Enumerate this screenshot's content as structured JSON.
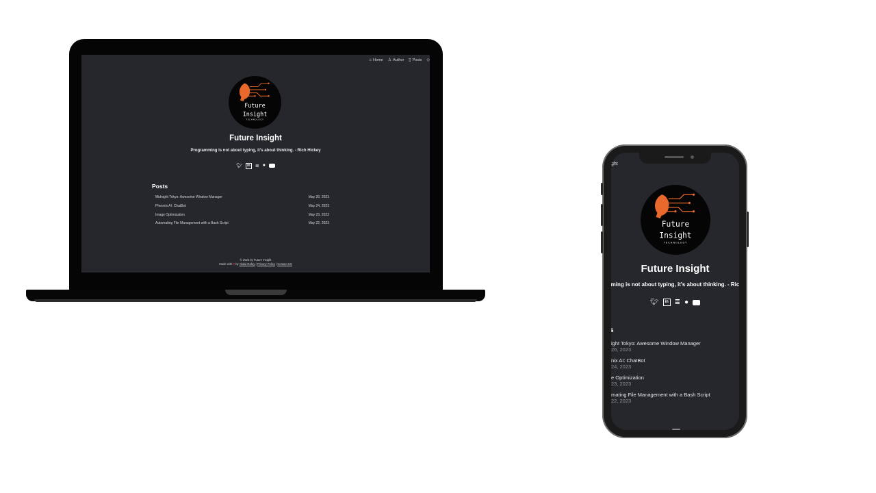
{
  "site": {
    "title": "Future Insight",
    "tagline": "Programming is not about typing, it's about thinking. - Rich Hickey",
    "logo_text_line1": "Future",
    "logo_text_line2": "Insight",
    "logo_text_line3": "TECHNOLOGY"
  },
  "nav": [
    {
      "label": "Home",
      "icon": "home-icon"
    },
    {
      "label": "Author",
      "icon": "user-icon"
    },
    {
      "label": "Posts",
      "icon": "book-icon"
    },
    {
      "label": "",
      "icon": "tag-icon"
    }
  ],
  "social": [
    "twitter-icon",
    "linkedin-icon",
    "stackoverflow-icon",
    "github-icon",
    "youtube-icon"
  ],
  "posts_heading": "Posts",
  "posts": [
    {
      "title": "Midnight Tokyo: Awesome Window Manager",
      "date": "May 26, 2023"
    },
    {
      "title": "Pheonix AI: ChatBot",
      "date": "May 24, 2023"
    },
    {
      "title": "Image Optimization",
      "date": "May 23, 2023"
    },
    {
      "title": "Automating File Management with a Bash Script",
      "date": "May 22, 2023"
    }
  ],
  "footer": {
    "copyright": "© 2023 by Future Insight",
    "made_with": "Made with",
    "by": "by",
    "author": "Abdul Rafay",
    "privacy": "Privacy Policy",
    "contact": "Contact US",
    "sep": "|"
  },
  "phone": {
    "nav_fragment": "ght",
    "quote_visible": "ming is not about typing, it's about thinking. - Ric",
    "posts_heading_visible": "s",
    "posts": [
      {
        "title": "ight Tokyo: Awesome Window Manager",
        "date": "26, 2023"
      },
      {
        "title": "nix AI: ChatBot",
        "date": "24, 2023"
      },
      {
        "title": "e Optimization",
        "date": "23, 2023"
      },
      {
        "title": "mating File Management with a Bash Script",
        "date": "22, 2023"
      }
    ]
  },
  "colors": {
    "page_bg": "#25272c",
    "accent_orange": "#e8692b",
    "heart": "#e23b3b"
  }
}
